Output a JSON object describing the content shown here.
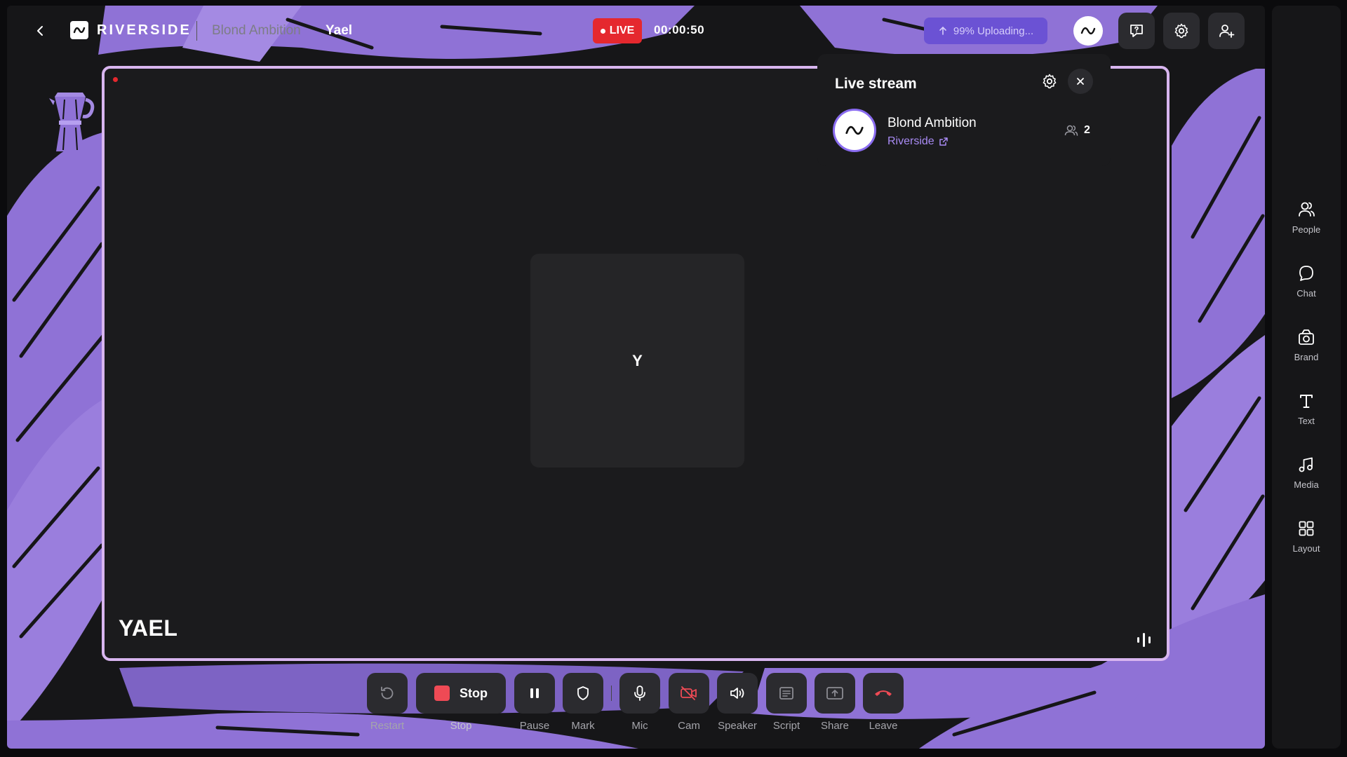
{
  "app": {
    "brand": "RIVERSIDE",
    "studio_name": "Blond Ambition",
    "user_name": "Yael"
  },
  "status": {
    "live_label": "LIVE",
    "timer": "00:00:50",
    "upload_label": "99% Uploading..."
  },
  "stage": {
    "tile_initial": "Y",
    "name_tag": "YAEL"
  },
  "live_panel": {
    "title": "Live stream",
    "stream_name": "Blond Ambition",
    "platform": "Riverside",
    "viewer_count": "2"
  },
  "controls": {
    "restart": "Restart",
    "stop_button": "Stop",
    "stop": "Stop",
    "pause": "Pause",
    "mark": "Mark",
    "mic": "Mic",
    "cam": "Cam",
    "speaker": "Speaker",
    "script": "Script",
    "share": "Share",
    "leave": "Leave"
  },
  "sidebar": {
    "items": [
      {
        "label": "People",
        "icon": "people-icon"
      },
      {
        "label": "Chat",
        "icon": "chat-icon"
      },
      {
        "label": "Brand",
        "icon": "brand-icon"
      },
      {
        "label": "Text",
        "icon": "text-icon"
      },
      {
        "label": "Media",
        "icon": "media-icon"
      },
      {
        "label": "Layout",
        "icon": "layout-icon"
      }
    ]
  },
  "colors": {
    "accent": "#8a6cf0",
    "live_red": "#e5282e",
    "stage_border": "#d8b5ef",
    "brush_purple": "#8f72d6",
    "leave_red": "#ef4a55"
  }
}
